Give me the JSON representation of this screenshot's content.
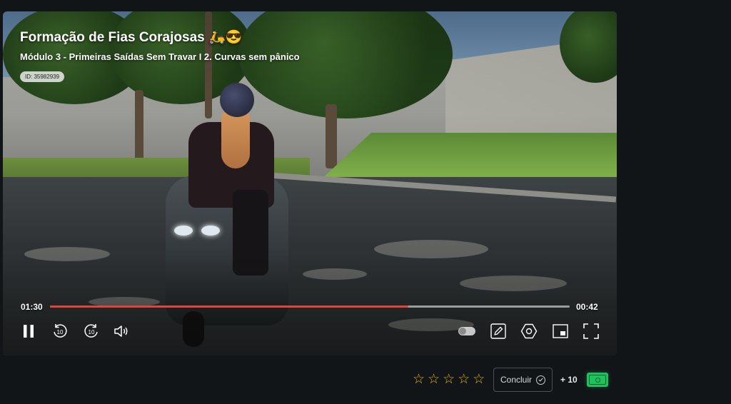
{
  "video": {
    "title": "Formação de Fias Corajosas 🛵😎",
    "subtitle": "Módulo 3 - Primeiras Saídas Sem Travar I 2. Curvas sem pânico",
    "id_label": "ID: 35982939",
    "current_time": "01:30",
    "duration": "00:42",
    "progress_fraction": 0.69,
    "progress_color": "#e0443a"
  },
  "controls": {
    "icons": [
      "pause-icon",
      "rewind-10-icon",
      "forward-10-icon",
      "volume-icon",
      "autoplay-toggle",
      "edit-icon",
      "settings-icon",
      "picture-in-picture-icon",
      "fullscreen-icon"
    ],
    "rewind_label": "10",
    "forward_label": "10"
  },
  "footer": {
    "rating_max": 5,
    "rating_value": 0,
    "star_glyph": "☆",
    "star_color": "#d9b125",
    "complete_label": "Concluir",
    "points_label": "+ 10",
    "points_icon": "money-icon",
    "points_icon_color": "#1fc25f"
  }
}
